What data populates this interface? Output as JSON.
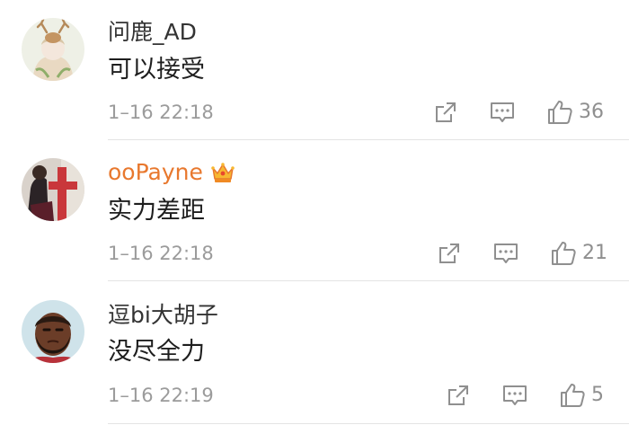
{
  "comments": [
    {
      "username": "问鹿_AD",
      "text": "可以接受",
      "time": "1–16 22:18",
      "likes": "36",
      "vip": false
    },
    {
      "username": "ooPayne",
      "text": "实力差距",
      "time": "1–16 22:18",
      "likes": "21",
      "vip": true
    },
    {
      "username": "逗bi大胡子",
      "text": "没尽全力",
      "time": "1–16 22:19",
      "likes": "5",
      "vip": false
    }
  ],
  "colors": {
    "vip_name": "#e8782e",
    "timestamp": "#9b9b9b",
    "icon": "#8f8f8f",
    "divider": "#e4e4e4"
  },
  "icons": [
    "share-icon",
    "reply-icon",
    "like-icon",
    "crown-vip-icon"
  ]
}
